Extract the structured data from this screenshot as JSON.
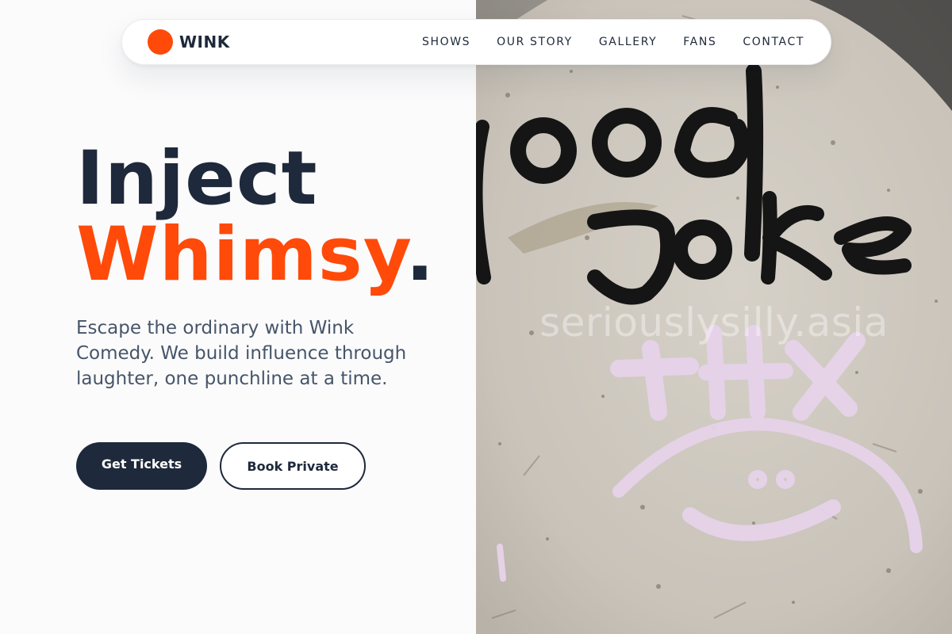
{
  "brand": {
    "name": "WINK",
    "color": "#ff4a0a"
  },
  "nav": {
    "links": [
      "SHOWS",
      "OUR STORY",
      "GALLERY",
      "FANS",
      "CONTACT"
    ]
  },
  "hero": {
    "headline_line1": "Inject",
    "headline_accent": "Whimsy",
    "headline_end": ".",
    "subtitle": "Escape the ordinary with Wink Comedy. We build influence through laughter, one punchline at a time.",
    "primary_cta": "Get Tickets",
    "secondary_cta": "Book Private"
  },
  "photo": {
    "watermark": "seriouslysilly.asia"
  },
  "colors": {
    "accent": "#ff4a0a",
    "dark": "#1e293b",
    "muted": "#475569",
    "background": "#fbfbfc"
  }
}
